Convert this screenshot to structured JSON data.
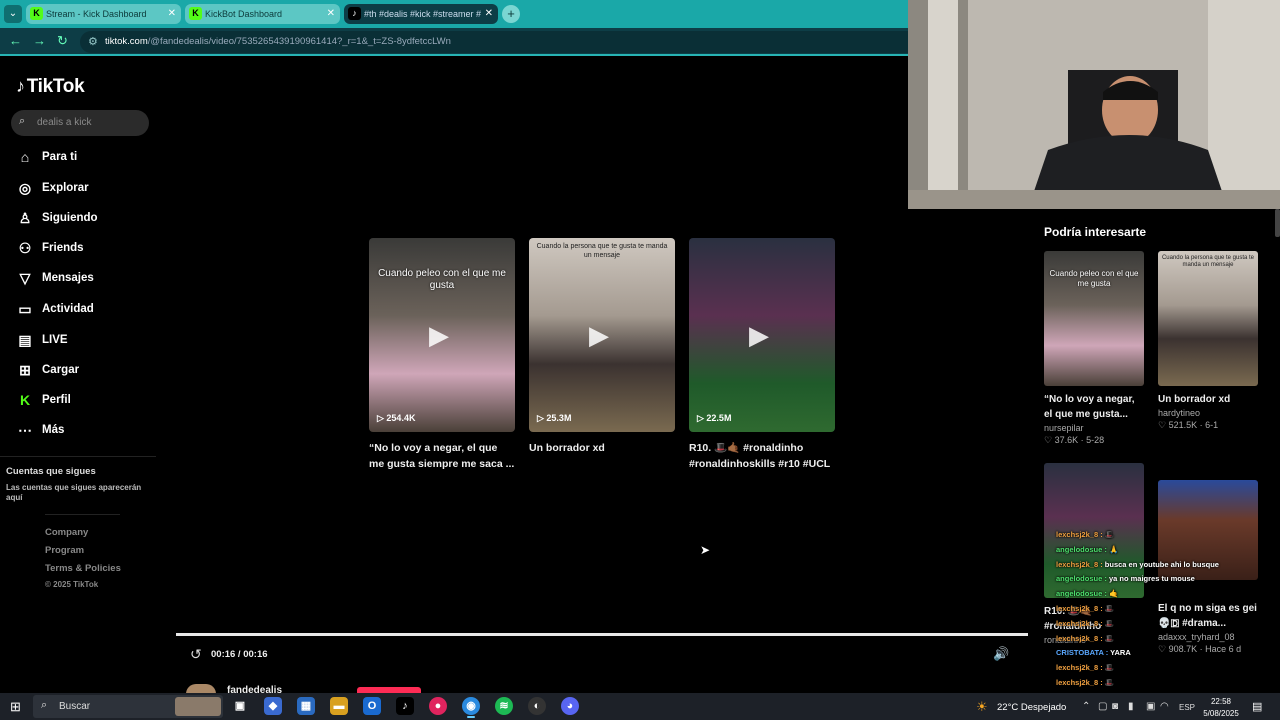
{
  "browser": {
    "tabs": [
      {
        "label": "Stream - Kick Dashboard",
        "favicon": "kick-icon"
      },
      {
        "label": "KickBot Dashboard",
        "favicon": "kickbot-icon"
      },
      {
        "label": "#th #dealis #kick #streamer #",
        "favicon": "tiktok-icon"
      }
    ],
    "url_host": "tiktok.com",
    "url_path": "/@fandedealis/video/7535265439190961414?_r=1&_t=ZS-8ydfetccLWn"
  },
  "sidebar": {
    "logo": "TikTok",
    "search_placeholder": "dealis a kick",
    "items": [
      {
        "label": "Para ti",
        "icon": "home-icon"
      },
      {
        "label": "Explorar",
        "icon": "compass-icon"
      },
      {
        "label": "Siguiendo",
        "icon": "user-following-icon"
      },
      {
        "label": "Friends",
        "icon": "friends-icon"
      },
      {
        "label": "Mensajes",
        "icon": "messages-icon"
      },
      {
        "label": "Actividad",
        "icon": "activity-icon"
      },
      {
        "label": "LIVE",
        "icon": "live-icon"
      },
      {
        "label": "Cargar",
        "icon": "upload-icon"
      },
      {
        "label": "Perfil",
        "icon": "profile-icon"
      },
      {
        "label": "Más",
        "icon": "more-icon"
      }
    ],
    "following_title": "Cuentas que sigues",
    "following_text": "Las cuentas que sigues aparecerán aquí",
    "footer": [
      "Company",
      "Program",
      "Terms & Policies"
    ],
    "copyright": "© 2025 TikTok"
  },
  "grid": [
    {
      "overlay": "Cuando peleo con el que me gusta",
      "views": "254.4K",
      "title": "“No lo voy a negar, el que me gusta siempre me saca ..."
    },
    {
      "overlay": "Cuando la persona que te gusta te manda un mensaje",
      "views": "25.3M",
      "title": "Un borrador xd"
    },
    {
      "overlay": "",
      "views": "22.5M",
      "title": "R10. 🎩🤙🏾 #ronaldinho #ronaldinhoskills #r10 #UCL"
    }
  ],
  "player": {
    "time": "00:16 / 00:16",
    "progress": 1.0,
    "author": "fandedealis"
  },
  "recommended": {
    "title": "Podría interesarte",
    "items": [
      {
        "overlay": "Cuando peleo con el que me gusta",
        "title": "“No lo voy a negar, el que me gusta...",
        "author": "nursepilar",
        "likes": "37.6K",
        "date": "5-28"
      },
      {
        "overlay": "Cuando la persona que te gusta te manda un mensaje",
        "title": "Un borrador xd",
        "author": "hardytineo",
        "likes": "521.5K",
        "date": "6-1"
      },
      {
        "overlay": "",
        "title": "R10. 🎩🤙🏾 #ronaldinho",
        "author": "ronaldinho",
        "likes": "",
        "date": ""
      },
      {
        "overlay": "",
        "title": "El q no m siga es gei 💀🇩 #drama...",
        "author": "adaxxx_tryhard_08",
        "likes": "908.7K",
        "date": "Hace 6 d"
      }
    ]
  },
  "chat": [
    {
      "user": "lexchsj2k_8 :",
      "msg": "🎩",
      "color": "u1"
    },
    {
      "user": "angelodosue :",
      "msg": "🙏",
      "color": "u2"
    },
    {
      "user": "lexchsj2k_8 :",
      "msg": "busca en youtube ahi lo busque",
      "color": "u1"
    },
    {
      "user": "angelodosue :",
      "msg": "ya no maigres tu mouse",
      "color": "u2"
    },
    {
      "user": "angelodosue :",
      "msg": "🤙",
      "color": "u2"
    },
    {
      "user": "lexchsj2k_8 :",
      "msg": "🎩",
      "color": "u1"
    },
    {
      "user": "lexchsj2k_8 :",
      "msg": "🎩",
      "color": "u1"
    },
    {
      "user": "lexchsj2k_8 :",
      "msg": "🎩",
      "color": "u1"
    },
    {
      "user": "CRISTOBATA :",
      "msg": "YARA",
      "color": "u3"
    },
    {
      "user": "lexchsj2k_8 :",
      "msg": "🎩",
      "color": "u1"
    },
    {
      "user": "lexchsj2k_8 :",
      "msg": "🎩",
      "color": "u1"
    }
  ],
  "taskbar": {
    "search_placeholder": "Buscar",
    "weather": "22°C  Despejado",
    "lang": "ESP",
    "time": "22:58",
    "date": "5/08/2025"
  },
  "colors": {
    "accent": "#fe2c55",
    "kick_green": "#53fc18",
    "chrome_teal": "#1aa8a8"
  }
}
